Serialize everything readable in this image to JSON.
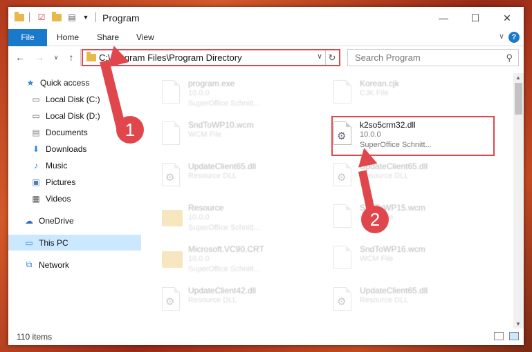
{
  "window": {
    "title": "Program",
    "controls": {
      "minimize": "—",
      "maximize": "☐",
      "close": "✕"
    }
  },
  "ribbon": {
    "tabs": [
      "File",
      "Home",
      "Share",
      "View"
    ],
    "help": "?"
  },
  "address": {
    "path": "C:\\Program Files\\Program Directory",
    "search_placeholder": "Search Program"
  },
  "sidebar": {
    "items": [
      {
        "label": "Quick access",
        "icon": "star-icon"
      },
      {
        "label": "Local Disk (C:)",
        "icon": "drive-icon",
        "pinned": true
      },
      {
        "label": "Local Disk (D:)",
        "icon": "drive-icon",
        "pinned": true
      },
      {
        "label": "Documents",
        "icon": "documents-icon",
        "pinned": true
      },
      {
        "label": "Downloads",
        "icon": "download-icon",
        "pinned": true
      },
      {
        "label": "Music",
        "icon": "music-icon",
        "pinned": true
      },
      {
        "label": "Pictures",
        "icon": "pictures-icon",
        "pinned": true
      },
      {
        "label": "Videos",
        "icon": "videos-icon",
        "pinned": true
      },
      {
        "label": "OneDrive",
        "icon": "cloud-icon"
      },
      {
        "label": "This PC",
        "icon": "computer-icon",
        "selected": true
      },
      {
        "label": "Network",
        "icon": "network-icon"
      }
    ]
  },
  "files": [
    {
      "name": "program.exe",
      "line2": "10.0.0",
      "line3": "SuperOffice Schnitt...",
      "icon": "exe"
    },
    {
      "name": "Korean.cjk",
      "line2": "CJK File",
      "line3": "",
      "icon": "doc"
    },
    {
      "name": "SndToWP10.wcm",
      "line2": "WCM File",
      "line3": "",
      "icon": "doc"
    },
    {
      "name": "k2so5crm32.dll",
      "line2": "10.0.0",
      "line3": "SuperOffice Schnitt...",
      "icon": "dll",
      "highlighted": true
    },
    {
      "name": "UpdateClient65.dll",
      "line2": "Resource DLL",
      "line3": "",
      "icon": "dll"
    },
    {
      "name": "UpdateClient65.dll",
      "line2": "Resource DLL",
      "line3": "",
      "icon": "dll"
    },
    {
      "name": "Resource",
      "line2": "10.0.0",
      "line3": "SuperOffice Schnitt...",
      "icon": "folder"
    },
    {
      "name": "SndToWP15.wcm",
      "line2": "WCM File",
      "line3": "",
      "icon": "doc"
    },
    {
      "name": "Microsoft.VC90.CRT",
      "line2": "10.0.0",
      "line3": "SuperOffice Schnitt...",
      "icon": "folder"
    },
    {
      "name": "SndToWP16.wcm",
      "line2": "WCM File",
      "line3": "",
      "icon": "doc"
    },
    {
      "name": "UpdateClient42.dll",
      "line2": "Resource DLL",
      "line3": "",
      "icon": "dll"
    },
    {
      "name": "UpdateClient65.dll",
      "line2": "Resource DLL",
      "line3": "",
      "icon": "dll"
    }
  ],
  "status": {
    "items_count": "110 items"
  },
  "annotations": {
    "step1": "1",
    "step2": "2",
    "color": "#e0474c"
  }
}
